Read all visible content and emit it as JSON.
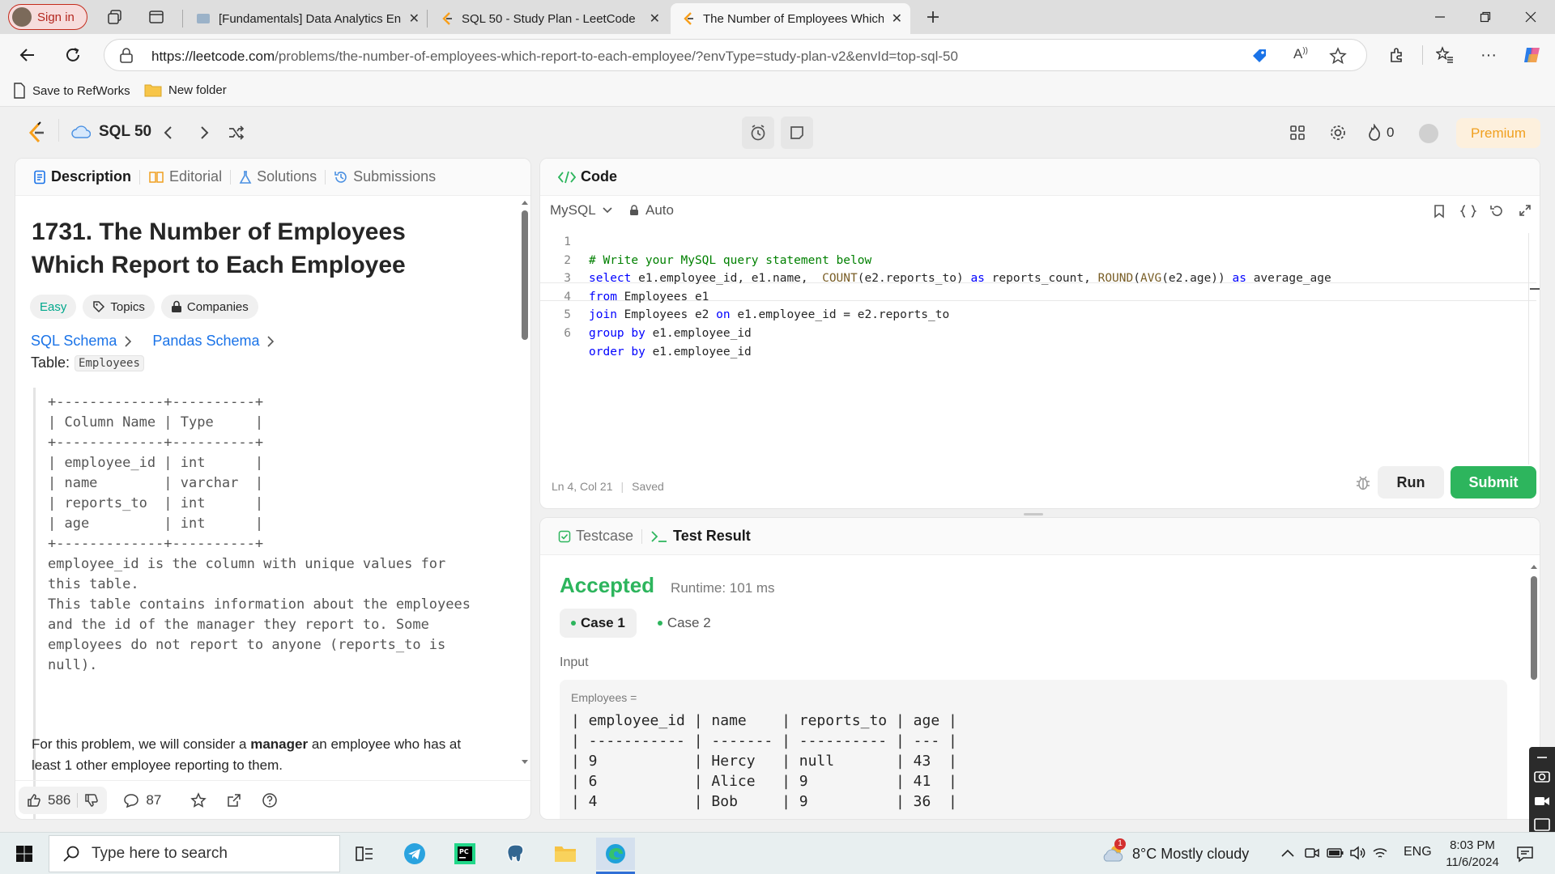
{
  "browser": {
    "signin_label": "Sign in",
    "tabs": [
      {
        "title": "[Fundamentals] Data Analytics En",
        "active": false
      },
      {
        "title": "SQL 50 - Study Plan - LeetCode",
        "active": false
      },
      {
        "title": "The Number of Employees Which",
        "active": true
      }
    ],
    "url_host": "https://leetcode.com",
    "url_path": "/problems/the-number-of-employees-which-report-to-each-employee/?envType=study-plan-v2&envId=top-sql-50",
    "favorites": [
      {
        "label": "Save to RefWorks",
        "icon": "document-icon"
      },
      {
        "label": "New folder",
        "icon": "folder-icon"
      }
    ]
  },
  "leetcode": {
    "studyplan_label": "SQL 50",
    "streak_count": "0",
    "premium_label": "Premium",
    "left_tabs": [
      "Description",
      "Editorial",
      "Solutions",
      "Submissions"
    ],
    "problem": {
      "title": "1731. The Number of Employees Which Report to Each Employee",
      "difficulty": "Easy",
      "topics_label": "Topics",
      "companies_label": "Companies",
      "sql_schema_label": "SQL Schema",
      "pandas_schema_label": "Pandas Schema",
      "table_prefix": "Table:",
      "table_name": "Employees",
      "schema_text": "+-------------+----------+\n| Column Name | Type     |\n+-------------+----------+\n| employee_id | int      |\n| name        | varchar  |\n| reports_to  | int      |\n| age         | int      |\n+-------------+----------+\nemployee_id is the column with unique values for\nthis table.\nThis table contains information about the employees\nand the id of the manager they report to. Some\nemployees do not report to anyone (reports_to is\nnull).",
      "desc_pre": "For this problem, we will consider a ",
      "desc_bold": "manager",
      "desc_post": " an employee who has at least 1 other employee reporting to them."
    },
    "actions": {
      "likes": "586",
      "comments": "87"
    },
    "code_panel": {
      "title": "Code",
      "language": "MySQL",
      "mode": "Auto",
      "status_pos": "Ln 4, Col 21",
      "status_saved": "Saved",
      "run_label": "Run",
      "submit_label": "Submit"
    },
    "code_lines": [
      "# Write your MySQL query statement below",
      "select e1.employee_id, e1.name,  COUNT(e2.reports_to) as reports_count, ROUND(AVG(e2.age)) as average_age",
      "from Employees e1",
      "join Employees e2 on e1.employee_id = e2.reports_to",
      "group by e1.employee_id",
      "order by e1.employee_id"
    ],
    "result_panel": {
      "tab_testcase": "Testcase",
      "tab_result": "Test Result",
      "status": "Accepted",
      "runtime": "Runtime: 101 ms",
      "cases": [
        "Case 1",
        "Case 2"
      ],
      "input_label": "Input",
      "var_label": "Employees =",
      "table_text": "| employee_id | name    | reports_to | age |\n| ----------- | ------- | ---------- | --- |\n| 9           | Hercy   | null       | 43  |\n| 6           | Alice   | 9          | 41  |\n| 4           | Bob     | 9          | 36  |"
    }
  },
  "taskbar": {
    "search_placeholder": "Type here to search",
    "weather": "8°C  Mostly cloudy",
    "weather_badge": "1",
    "lang": "ENG",
    "time": "8:03 PM",
    "date": "11/6/2024"
  },
  "colors": {
    "accent_green": "#2db55d",
    "easy_teal": "#00a88c",
    "link_blue": "#1a73e8",
    "premium_orange": "#f0a020"
  }
}
